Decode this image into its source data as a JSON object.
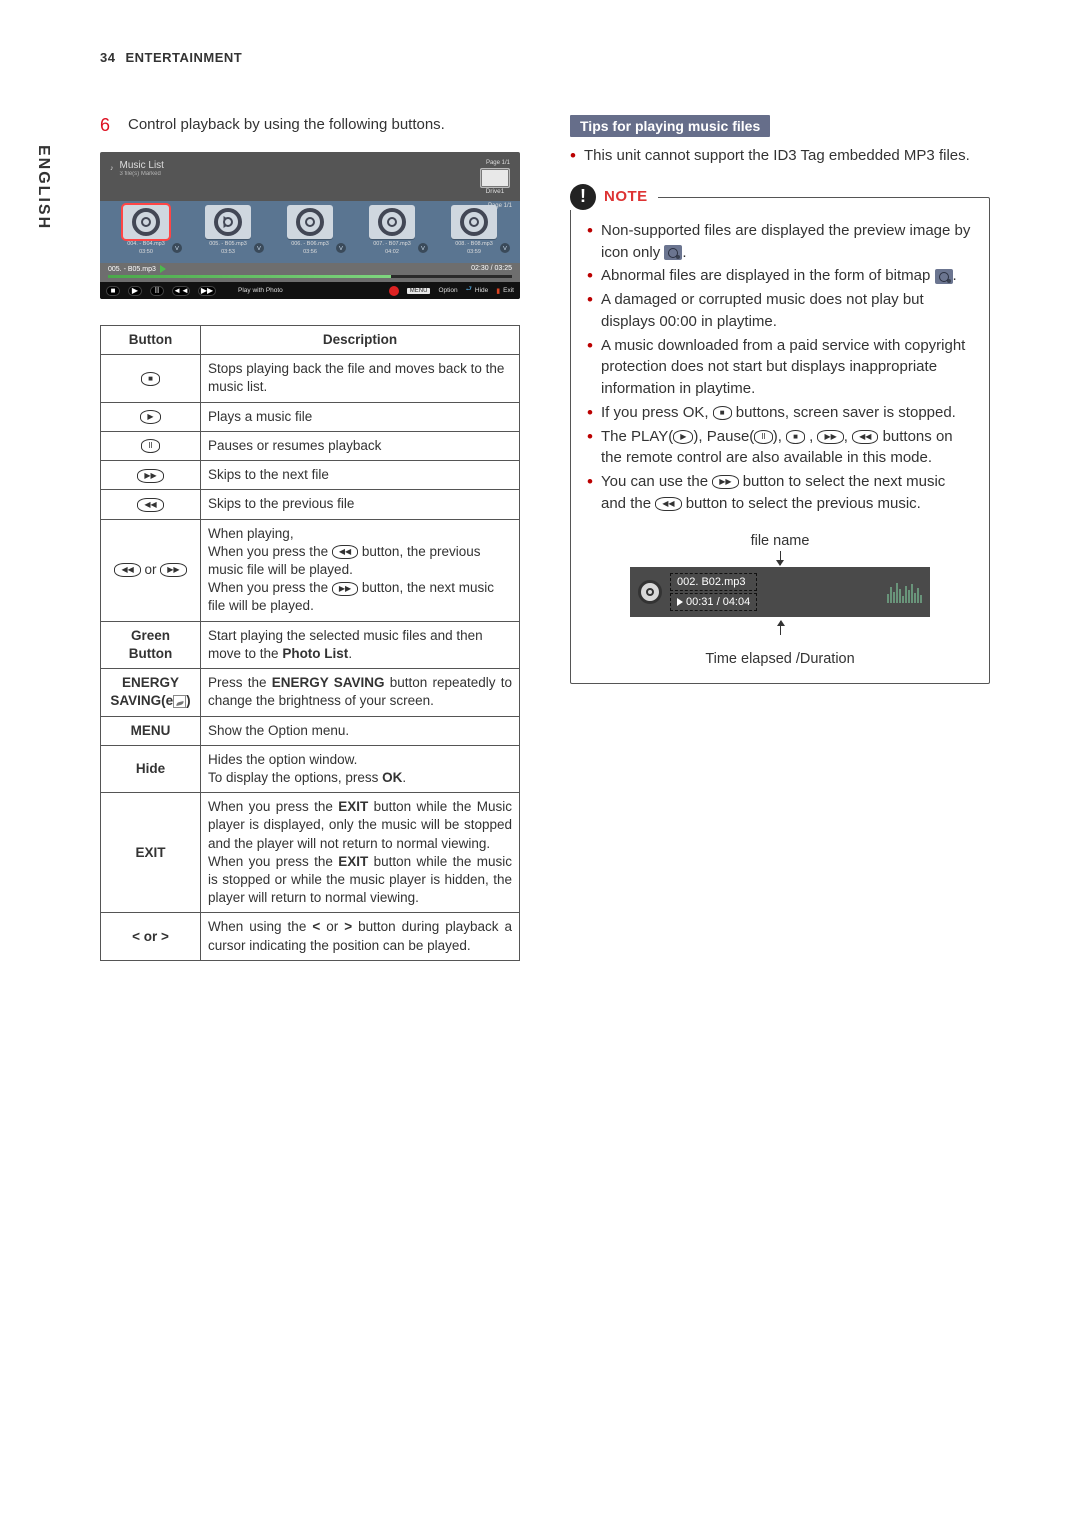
{
  "header": {
    "page_number": "34",
    "section": "ENTERTAINMENT"
  },
  "sidebar": {
    "language": "ENGLISH"
  },
  "left": {
    "step": {
      "number": "6",
      "text": "Control playback by using the following buttons."
    },
    "mock": {
      "header_title": "Music List",
      "header_sub": "3 file(s) Marked",
      "header_page": "Page 1/1",
      "drive": "Drive1",
      "body_page": "Page 1/1",
      "tiles": [
        {
          "label1": "004. - B04.mp3",
          "label2": "03:50",
          "highlighted": true
        },
        {
          "label1": "005. - B05.mp3",
          "label2": "03:53"
        },
        {
          "label1": "006. - B06.mp3",
          "label2": "03:56"
        },
        {
          "label1": "007. - B07.mp3",
          "label2": "04:02"
        },
        {
          "label1": "008. - B08.mp3",
          "label2": "03:59"
        }
      ],
      "track_name": "005. - B05.mp3",
      "track_time": "02:30 / 03:25",
      "bottom": {
        "stop": "■",
        "play": "▶",
        "pause": "II",
        "prev": "◄◄",
        "next": "▶▶",
        "play_with_photo": "Play with Photo",
        "option": "Option",
        "hide": "Hide",
        "exit": "Exit",
        "menu": "MENU"
      }
    },
    "table": {
      "head_button": "Button",
      "head_description": "Description",
      "rows": [
        {
          "btn_glyph": "■",
          "desc": "Stops playing back the file and moves back to the music list."
        },
        {
          "btn_glyph": "▶",
          "desc": "Plays a music file"
        },
        {
          "btn_glyph": "II",
          "desc": "Pauses or resumes playback"
        },
        {
          "btn_glyph": "▶▶",
          "desc": "Skips to the next file"
        },
        {
          "btn_glyph": "◀◀",
          "desc": "Skips to the previous file"
        },
        {
          "btn_text": "◀◀ or ▶▶",
          "desc_parts": [
            "When playing,",
            "When you press the ",
            "◀◀",
            " button, the previous music file will be played.",
            "When you press the ",
            "▶▶",
            " button, the next music file will be played."
          ]
        },
        {
          "btn_text": "Green Button",
          "desc_bold_tail": "Photo List",
          "desc_pre": "Start playing the selected music files and then move to the ",
          "desc_post": "."
        },
        {
          "btn_text": "ENERGY SAVING(e",
          "btn_suffix": ")",
          "desc_pre": "Press the ",
          "desc_bold": "ENERGY SAVING",
          "desc_post": " button repeatedly to change the brightness of your screen."
        },
        {
          "btn_text": "MENU",
          "desc": "Show the Option menu."
        },
        {
          "btn_text": "Hide",
          "desc_pre": "Hides the option window.\nTo display the options, press ",
          "desc_bold": "OK",
          "desc_post": "."
        },
        {
          "btn_text": "EXIT",
          "desc_parts2": [
            "When you press the ",
            "EXIT",
            " button while the Music player is displayed, only the music will be stopped and the player will not return to normal viewing.",
            "When you press the ",
            "EXIT",
            " button while the music is stopped or while the music player is hidden, the player will return to normal  viewing."
          ]
        },
        {
          "btn_text": "< or >",
          "desc_parts3": [
            "When using the ",
            "<",
            " or ",
            ">",
            " button during playback a cursor indicating the position can be played."
          ]
        }
      ]
    }
  },
  "right": {
    "tips_title": "Tips for playing music files",
    "tips_bullet1": "This unit cannot support the ID3 Tag embedded MP3 files.",
    "note_label": "NOTE",
    "notes": [
      {
        "pre": "Non-supported files are displayed the preview image by icon only ",
        "icon": true,
        "post": "."
      },
      {
        "pre": "Abnormal files are displayed in the form of bitmap ",
        "icon": true,
        "post": "."
      },
      {
        "text": "A damaged or corrupted music does not play but displays 00:00 in playtime."
      },
      {
        "text": "A music downloaded from a paid service with copyright protection does not start but displays inappropriate information in playtime."
      },
      {
        "pre": "If you press OK, ",
        "btn": "■",
        "post": " buttons, screen saver is stopped."
      },
      {
        "play_line": true,
        "t1": "The PLAY(",
        "b1": "▶",
        "t2": "), Pause(",
        "b2": "II",
        "t3": "), ",
        "b3": "■",
        "t4": " , ",
        "b4": "▶▶",
        "t5": ", ",
        "b5": "◀◀",
        "t6": " buttons on the remote control are also available in this mode."
      },
      {
        "use_line": true,
        "u1": "You can use the ",
        "ub1": "▶▶",
        "u2": " button to select the next music and the ",
        "ub2": "◀◀",
        "u3": " button to select the previous music."
      }
    ],
    "player": {
      "fn_label": "file name",
      "track": "002. B02.mp3",
      "time": "00:31 / 04:04",
      "caption": "Time elapsed /Duration"
    }
  }
}
